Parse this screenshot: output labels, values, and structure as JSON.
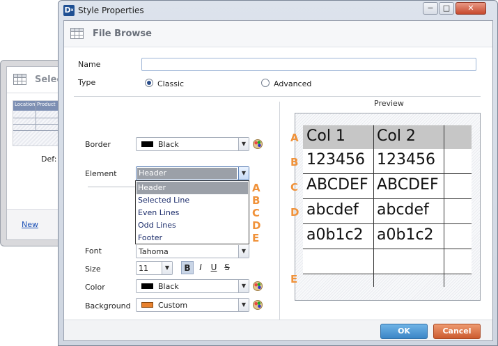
{
  "background_window": {
    "title": "Selec",
    "preview_headers": [
      "Location",
      "Product"
    ],
    "def_text": "Def:",
    "new_link": "New"
  },
  "dialog": {
    "title": "Style Properties",
    "app_icon_letter": "D",
    "app_icon_sub": "x",
    "controls": {
      "minimize": "−",
      "maximize": "□",
      "close": "✕"
    },
    "header_title": "File Browse"
  },
  "form": {
    "name_label": "Name",
    "name_value": "",
    "type_label": "Type",
    "type_options": [
      {
        "label": "Classic",
        "selected": true
      },
      {
        "label": "Advanced",
        "selected": false
      }
    ],
    "border_label": "Border",
    "border_value": "Black",
    "border_color": "#000000",
    "element_label": "Element",
    "element_value": "Header",
    "element_options": [
      "Header",
      "Selected Line",
      "Even Lines",
      "Odd Lines",
      "Footer"
    ],
    "element_markers": [
      "A",
      "B",
      "C",
      "D",
      "E"
    ],
    "font_label": "Font",
    "font_value": "Tahoma",
    "size_label": "Size",
    "size_value": "11",
    "format_buttons": {
      "bold": "B",
      "italic": "I",
      "underline": "U",
      "strike": "S"
    },
    "color_label": "Color",
    "color_value": "Black",
    "color_swatch": "#000000",
    "background_label": "Background",
    "background_value": "Custom",
    "background_swatch": "#e8822f"
  },
  "preview": {
    "title": "Preview",
    "row_markers": [
      "A",
      "B",
      "C",
      "D",
      "",
      "",
      "E"
    ],
    "rows": [
      [
        "Col 1",
        "Col 2"
      ],
      [
        "123456",
        "123456"
      ],
      [
        "ABCDEF",
        "ABCDEF"
      ],
      [
        "abcdef",
        "abcdef"
      ],
      [
        "a0b1c2",
        "a0b1c2"
      ],
      [
        "",
        ""
      ]
    ]
  },
  "buttons": {
    "ok": "OK",
    "cancel": "Cancel"
  },
  "colors": {
    "accent_marker": "#f0923a",
    "ok_button": "#3b86c6",
    "cancel_button": "#cc5b2f"
  }
}
